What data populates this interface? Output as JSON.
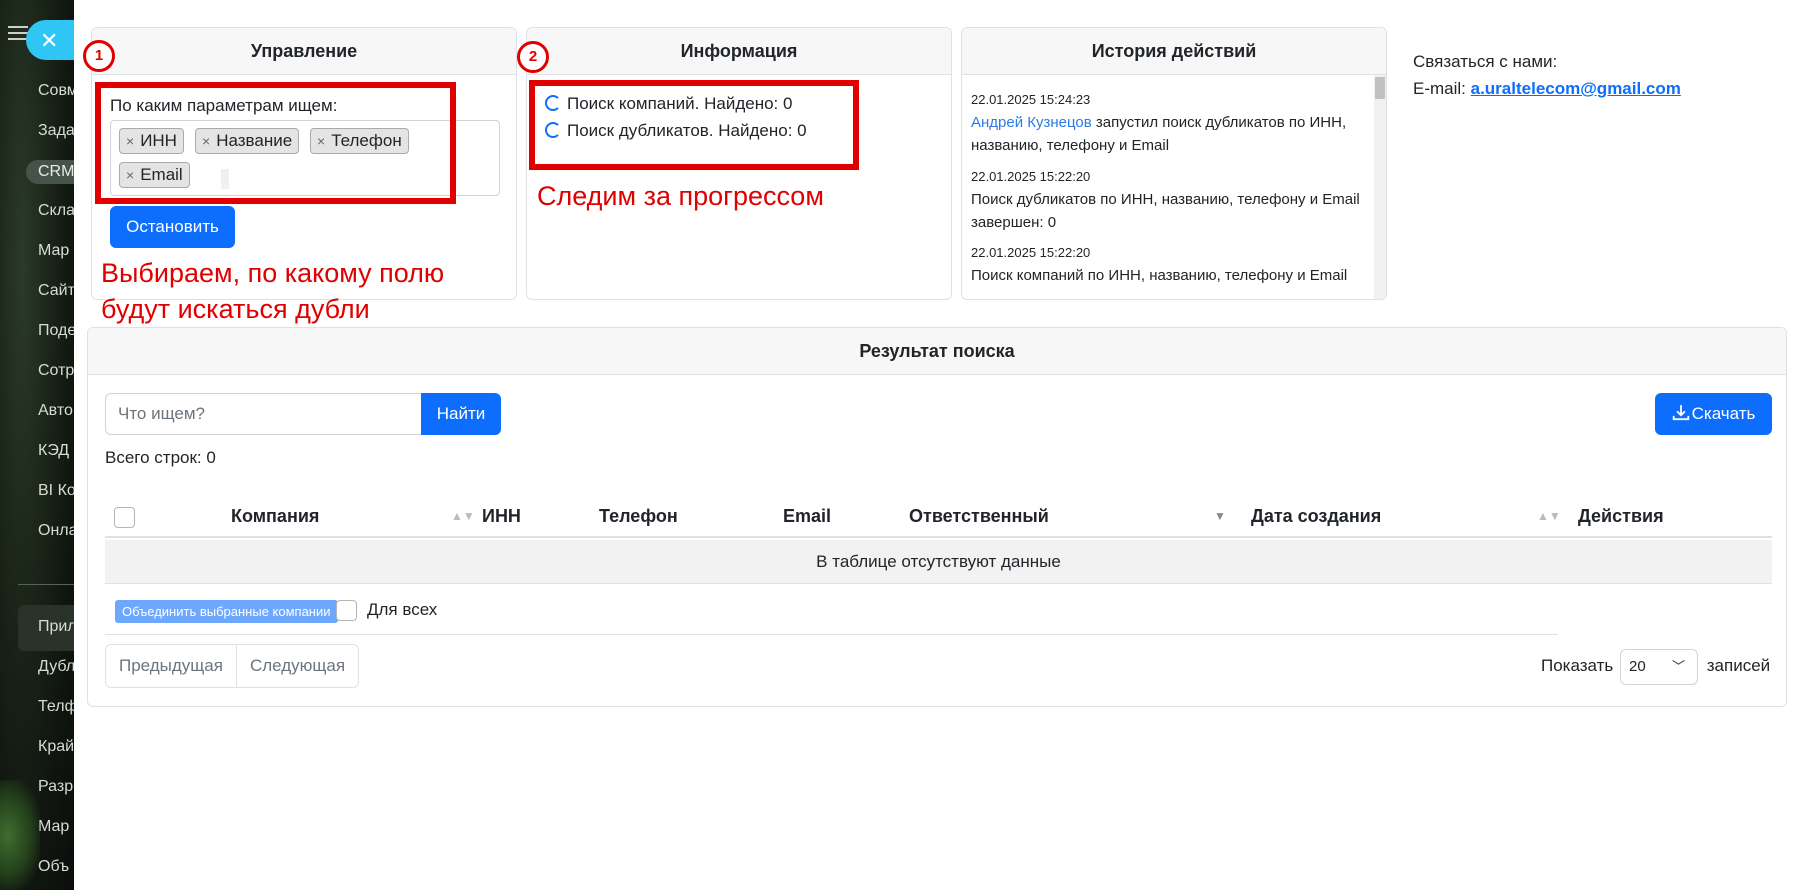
{
  "background_menu": {
    "items": [
      "Совм",
      "Зада",
      "CRM",
      "Скла",
      "Мар",
      "Сайт",
      "Поде",
      "Сотр",
      "Авто",
      "КЭД",
      "BI Ко",
      "Онла",
      "Прил",
      "Дубл",
      "Телф",
      "Край",
      "Разр",
      "Мар",
      "Объ"
    ]
  },
  "management": {
    "title": "Управление",
    "params_label": "По каким параметрам ищем:",
    "tags": [
      "ИНН",
      "Название",
      "Телефон",
      "Email"
    ],
    "tag_remove_glyph": "×",
    "stop_button": "Остановить"
  },
  "information": {
    "title": "Информация",
    "lines": [
      "Поиск компаний. Найдено: 0",
      "Поиск дубликатов. Найдено: 0"
    ]
  },
  "history": {
    "title": "История действий",
    "entries": [
      {
        "date": "22.01.2025 15:24:23",
        "user": "Андрей Кузнецов",
        "text": " запустил поиск дубликатов по ИНН, названию, телефону и Email"
      },
      {
        "date": "22.01.2025 15:22:20",
        "user": "",
        "text": "Поиск дубликатов по ИНН, названию, телефону и Email завершен: 0"
      },
      {
        "date": "22.01.2025 15:22:20",
        "user": "",
        "text": "Поиск компаний по ИНН, названию, телефону и Email"
      }
    ]
  },
  "contact": {
    "label": "Связаться с нами:",
    "email_prefix": "E-mail: ",
    "email": "a.uraltelecom@gmail.com"
  },
  "results": {
    "title": "Результат поиска",
    "search_placeholder": "Что ищем?",
    "find_button": "Найти",
    "download_button": "Скачать",
    "total_rows": "Всего строк: 0",
    "columns": [
      "Компания",
      "ИНН",
      "Телефон",
      "Email",
      "Ответственный",
      "Дата создания",
      "Действия"
    ],
    "empty_text": "В таблице отсутствуют данные",
    "merge_button": "Объединить выбранные компании",
    "for_all_label": "Для всех",
    "prev_button": "Предыдущая",
    "next_button": "Следующая",
    "show_label": "Показать",
    "page_size": "20",
    "records_label": "записей"
  },
  "annotations": {
    "marker1": "1",
    "marker2": "2",
    "text1_line1": "Выбираем, по какому полю",
    "text1_line2": "будут искаться дубли",
    "text2": "Следим за прогрессом",
    "color": "#e00000"
  },
  "colors": {
    "primary": "#0d6efd",
    "link": "#2c7be5",
    "close_pill": "#2fc6f6"
  }
}
